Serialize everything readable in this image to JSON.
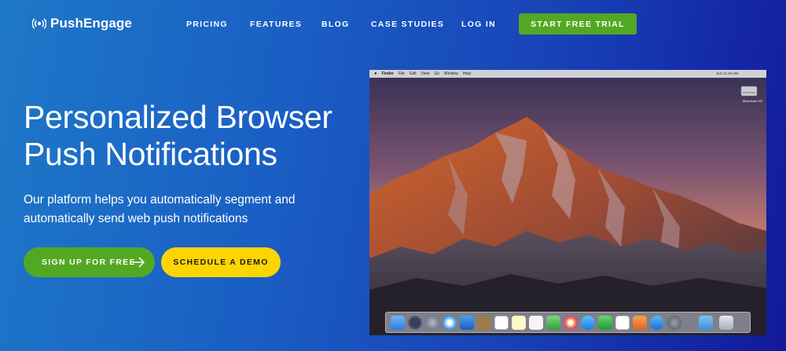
{
  "brand": {
    "name": "PushEngage"
  },
  "nav": {
    "links": [
      "PRICING",
      "FEATURES",
      "BLOG",
      "CASE STUDIES",
      "LOG IN"
    ],
    "cta": "START FREE TRIAL"
  },
  "hero": {
    "headline_line1": "Personalized Browser",
    "headline_line2": "Push Notifications",
    "subtext_line1": "Our platform helps you automatically segment and",
    "subtext_line2": "automatically send web push notifications",
    "primary_button": "SIGN UP FOR FREE",
    "secondary_button": "SCHEDULE A DEMO"
  },
  "mac_screenshot": {
    "menu_items": [
      "Finder",
      "File",
      "Edit",
      "View",
      "Go",
      "Window",
      "Help"
    ],
    "clock": "Sun 11:10 AM",
    "desktop_icon_label": "Macintosh HD"
  },
  "colors": {
    "green": "#53a823",
    "yellow": "#fdd500",
    "background_start": "#1e78c8",
    "background_end": "#12199a"
  }
}
